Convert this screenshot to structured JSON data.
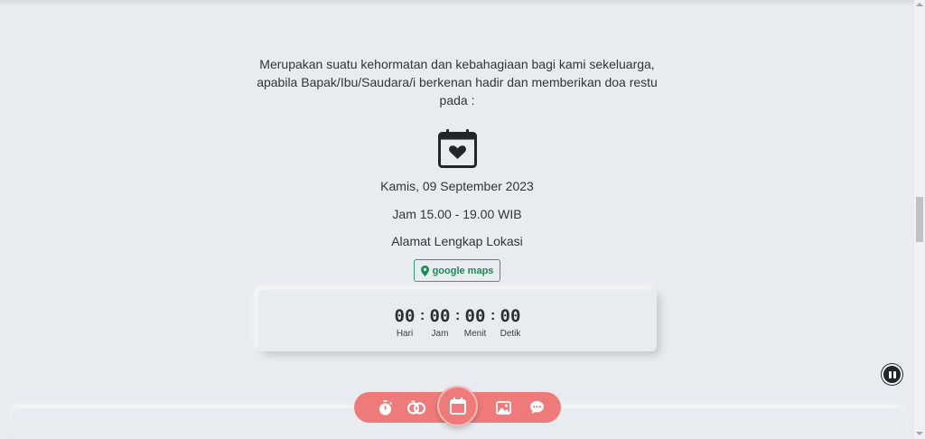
{
  "invitation": {
    "line1": "Merupakan suatu kehormatan dan kebahagiaan bagi kami sekeluarga,",
    "line2": "apabila Bapak/Ibu/Saudara/i berkenan hadir dan memberikan doa restu",
    "line3": "pada :"
  },
  "event": {
    "date": "Kamis, 09 September 2023",
    "time": "Jam 15.00 - 19.00 WIB",
    "address": "Alamat Lengkap Lokasi",
    "maps_label": "google maps",
    "icon": "calendar-heart-icon"
  },
  "countdown": {
    "days": "00",
    "days_label": "Hari",
    "hours": "00",
    "hours_label": "Jam",
    "minutes": "00",
    "minutes_label": "Menit",
    "seconds": "00",
    "seconds_label": "Detik",
    "separator": ":"
  },
  "nav": {
    "items": [
      "stopwatch-icon",
      "rings-icon",
      "calendar-icon",
      "gallery-icon",
      "chat-icon"
    ],
    "active": "calendar-icon"
  },
  "colors": {
    "background": "#e8ebef",
    "nav": "#ee7b79",
    "maps": "#1f8a55"
  }
}
